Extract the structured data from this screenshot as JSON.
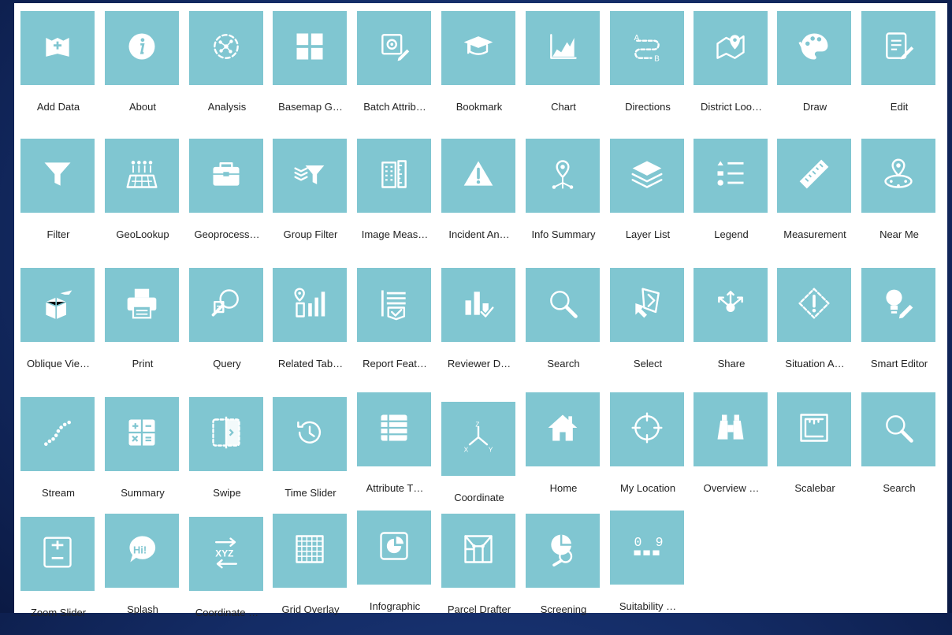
{
  "widgets": [
    [
      {
        "label": "Add Data",
        "icon": "add-data-icon"
      },
      {
        "label": "About",
        "icon": "info-icon"
      },
      {
        "label": "Analysis",
        "icon": "analysis-icon"
      },
      {
        "label": "Basemap G…",
        "icon": "basemap-gallery-icon"
      },
      {
        "label": "Batch Attrib…",
        "icon": "batch-attribute-icon"
      },
      {
        "label": "Bookmark",
        "icon": "bookmark-icon"
      },
      {
        "label": "Chart",
        "icon": "chart-icon"
      },
      {
        "label": "Directions",
        "icon": "directions-icon"
      },
      {
        "label": "District Loo…",
        "icon": "district-lookup-icon"
      },
      {
        "label": "Draw",
        "icon": "palette-icon"
      },
      {
        "label": "Edit",
        "icon": "edit-icon"
      }
    ],
    [
      {
        "label": "Filter",
        "icon": "filter-icon"
      },
      {
        "label": "GeoLookup",
        "icon": "geolookup-icon"
      },
      {
        "label": "Geoprocess…",
        "icon": "toolbox-icon"
      },
      {
        "label": "Group Filter",
        "icon": "group-filter-icon"
      },
      {
        "label": "Image Meas…",
        "icon": "image-measurement-icon"
      },
      {
        "label": "Incident An…",
        "icon": "warning-icon"
      },
      {
        "label": "Info Summary",
        "icon": "info-summary-icon"
      },
      {
        "label": "Layer List",
        "icon": "layers-icon"
      },
      {
        "label": "Legend",
        "icon": "legend-icon"
      },
      {
        "label": "Measurement",
        "icon": "ruler-icon"
      },
      {
        "label": "Near Me",
        "icon": "near-me-icon"
      }
    ],
    [
      {
        "label": "Oblique Vie…",
        "icon": "oblique-viewer-icon"
      },
      {
        "label": "Print",
        "icon": "printer-icon"
      },
      {
        "label": "Query",
        "icon": "query-icon"
      },
      {
        "label": "Related Tab…",
        "icon": "related-table-icon"
      },
      {
        "label": "Report Feat…",
        "icon": "report-feature-icon"
      },
      {
        "label": "Reviewer D…",
        "icon": "reviewer-dashboard-icon"
      },
      {
        "label": "Search",
        "icon": "search-icon"
      },
      {
        "label": "Select",
        "icon": "select-icon"
      },
      {
        "label": "Share",
        "icon": "share-icon"
      },
      {
        "label": "Situation A…",
        "icon": "situation-awareness-icon"
      },
      {
        "label": "Smart Editor",
        "icon": "smart-editor-icon"
      }
    ],
    [
      {
        "label": "Stream",
        "icon": "stream-icon"
      },
      {
        "label": "Summary",
        "icon": "calculator-icon"
      },
      {
        "label": "Swipe",
        "icon": "swipe-icon"
      },
      {
        "label": "Time Slider",
        "icon": "clock-icon"
      },
      {
        "label": "Attribute T…",
        "icon": "attribute-table-icon"
      },
      {
        "label": "Coordinate",
        "icon": "coordinate-axes-icon"
      },
      {
        "label": "Home",
        "icon": "home-icon"
      },
      {
        "label": "My Location",
        "icon": "crosshair-icon"
      },
      {
        "label": "Overview …",
        "icon": "binoculars-icon"
      },
      {
        "label": "Scalebar",
        "icon": "scalebar-icon"
      },
      {
        "label": "Search",
        "icon": "search-icon"
      }
    ],
    [
      {
        "label": "Zoom Slider",
        "icon": "zoom-slider-icon"
      },
      {
        "label": "Splash",
        "icon": "splash-icon"
      },
      {
        "label": "Coordinate …",
        "icon": "coordinate-conversion-icon"
      },
      {
        "label": "Grid Overlay",
        "icon": "grid-icon"
      },
      {
        "label": "Infographic",
        "icon": "infographic-icon"
      },
      {
        "label": "Parcel Drafter",
        "icon": "parcel-drafter-icon"
      },
      {
        "label": "Screening",
        "icon": "screening-icon"
      },
      {
        "label": "Suitability …",
        "icon": "suitability-icon"
      }
    ]
  ],
  "digits_09": "0 9",
  "hi_text": "Hi!",
  "xyz_text": "XYZ",
  "dir_a": "A",
  "dir_b": "B",
  "axis_x": "X",
  "axis_y": "Y",
  "axis_z": "Z"
}
